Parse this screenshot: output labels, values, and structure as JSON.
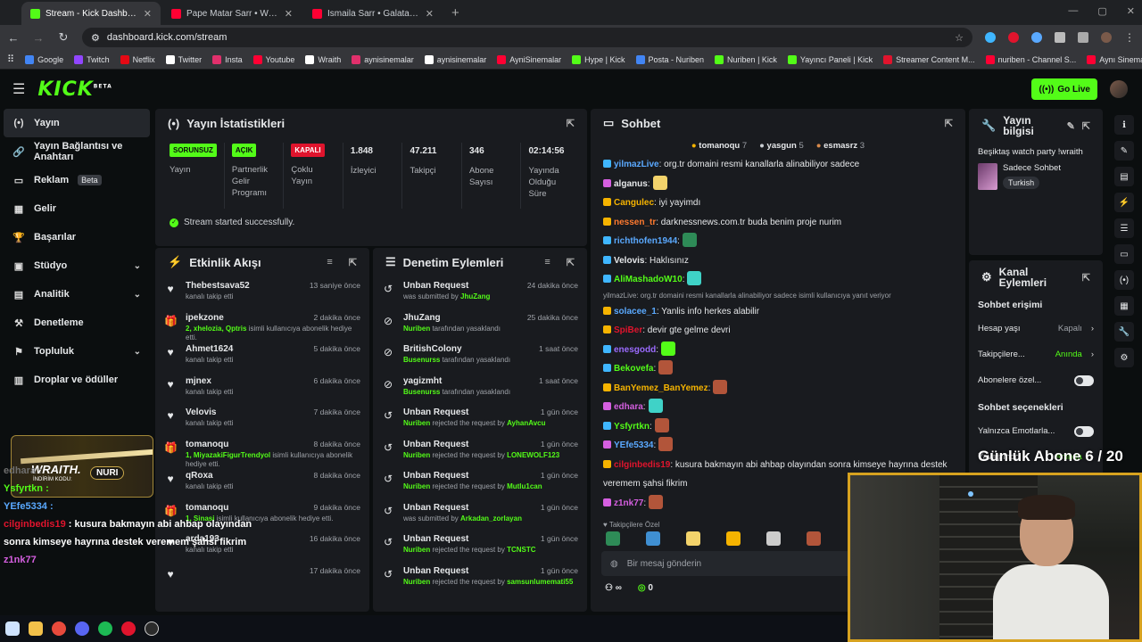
{
  "browser": {
    "tabs": [
      {
        "title": "Stream - Kick Dashboard",
        "color": "#53fc18"
      },
      {
        "title": "Pape Matar Sarr • Welcome to",
        "color": "#ff0033"
      },
      {
        "title": "Ismaila Sarr • Galatasaray Tran",
        "color": "#ff0033"
      }
    ],
    "url": "dashboard.kick.com/stream",
    "bookmarks": [
      {
        "label": "Google",
        "color": "#4285f4"
      },
      {
        "label": "Twitch",
        "color": "#9146ff"
      },
      {
        "label": "Netflix",
        "color": "#e50914"
      },
      {
        "label": "Twitter",
        "color": "#ffffff"
      },
      {
        "label": "Insta",
        "color": "#e1306c"
      },
      {
        "label": "Youtube",
        "color": "#ff0033"
      },
      {
        "label": "Wraith",
        "color": "#ffffff"
      },
      {
        "label": "aynisinemalar",
        "color": "#e1306c"
      },
      {
        "label": "aynisinemalar",
        "color": "#ffffff"
      },
      {
        "label": "AyniSinemalar",
        "color": "#ff0033"
      },
      {
        "label": "Hype | Kick",
        "color": "#53fc18"
      },
      {
        "label": "Posta - Nuriben",
        "color": "#4285f4"
      },
      {
        "label": "Nuriben | Kick",
        "color": "#53fc18"
      },
      {
        "label": "Yayıncı Paneli | Kick",
        "color": "#53fc18"
      },
      {
        "label": "Streamer Content M...",
        "color": "#e0142d"
      },
      {
        "label": "nuriben - Channel S...",
        "color": "#ff0033"
      },
      {
        "label": "Aynı Sinemalar - Ça...",
        "color": "#ff0033"
      }
    ]
  },
  "header": {
    "go_live": "Go Live"
  },
  "sidebar": {
    "items": [
      {
        "label": "Yayın",
        "icon": "(•)"
      },
      {
        "label": "Yayın Bağlantısı ve Anahtarı",
        "icon": "🔗"
      },
      {
        "label": "Reklam",
        "icon": "▭",
        "badge": "Beta"
      },
      {
        "label": "Gelir",
        "icon": "▦"
      },
      {
        "label": "Başarılar",
        "icon": "🏆"
      },
      {
        "label": "Stüdyo",
        "icon": "▣"
      },
      {
        "label": "Analitik",
        "icon": "▤"
      },
      {
        "label": "Denetleme",
        "icon": "⚒"
      },
      {
        "label": "Topluluk",
        "icon": "⚑"
      },
      {
        "label": "Droplar ve ödüller",
        "icon": "▥"
      }
    ],
    "promo": {
      "title": "WRAITH.",
      "code_label": "İNDİRİM KODU:",
      "code": "NURI"
    }
  },
  "stream_stats": {
    "title": "Yayın İstatistikleri",
    "stats": [
      {
        "badge": "SORUNSUZ",
        "label": "Yayın"
      },
      {
        "badge": "AÇIK",
        "label": "Partnerlik Gelir Programı"
      },
      {
        "badge": "KAPALI",
        "label": "Çoklu Yayın"
      },
      {
        "value": "1.848",
        "label": "İzleyici"
      },
      {
        "value": "47.211",
        "label": "Takipçi"
      },
      {
        "value": "346",
        "label": "Abone Sayısı"
      },
      {
        "value": "02:14:56",
        "label": "Yayında Olduğu Süre"
      }
    ],
    "status": "Stream started successfully."
  },
  "activity": {
    "title": "Etkinlik Akışı",
    "items": [
      {
        "icon": "♥",
        "name": "Thebestsava52",
        "time": "13 saniye önce",
        "sub": "kanalı takip etti"
      },
      {
        "icon": "🎁",
        "name": "ipekzone",
        "time": "2 dakika önce",
        "sub_highlight": "2, xhelozia, Qptris",
        "sub": " isimli kullanıcıya abonelik hediye etti."
      },
      {
        "icon": "♥",
        "name": "Ahmet1624",
        "time": "5 dakika önce",
        "sub": "kanalı takip etti"
      },
      {
        "icon": "♥",
        "name": "mjnex",
        "time": "6 dakika önce",
        "sub": "kanalı takip etti"
      },
      {
        "icon": "♥",
        "name": "Velovis",
        "time": "7 dakika önce",
        "sub": "kanalı takip etti"
      },
      {
        "icon": "🎁",
        "name": "tomanoqu",
        "time": "8 dakika önce",
        "sub_highlight": "1, MiyazakiFigurTrendyol",
        "sub": " isimli kullanıcıya abonelik hediye etti."
      },
      {
        "icon": "♥",
        "name": "qRoxa",
        "time": "8 dakika önce",
        "sub": "kanalı takip etti"
      },
      {
        "icon": "🎁",
        "name": "tomanoqu",
        "time": "9 dakika önce",
        "sub_highlight": "1, Sinasi",
        "sub": " isimli kullanıcıya abonelik hediye etti."
      },
      {
        "icon": "♥",
        "name": "arda193",
        "time": "16 dakika önce",
        "sub": "kanalı takip etti"
      },
      {
        "icon": "♥",
        "name": "",
        "time": "17 dakika önce",
        "sub": ""
      }
    ]
  },
  "moderation": {
    "title": "Denetim Eylemleri",
    "items": [
      {
        "icon": "↺",
        "name": "Unban Request",
        "time": "24 dakika önce",
        "pre": "was submitted by ",
        "hl": "JhuZang",
        "post": ""
      },
      {
        "icon": "⊘",
        "name": "JhuZang",
        "time": "25 dakika önce",
        "pre": "",
        "hl": "Nuriben",
        "post": " tarafından yasaklandı"
      },
      {
        "icon": "⊘",
        "name": "BritishColony",
        "time": "1 saat önce",
        "pre": "",
        "hl": "Busenurss",
        "post": " tarafından yasaklandı"
      },
      {
        "icon": "⊘",
        "name": "yagizmht",
        "time": "1 saat önce",
        "pre": "",
        "hl": "Busenurss",
        "post": " tarafından yasaklandı"
      },
      {
        "icon": "↺",
        "name": "Unban Request",
        "time": "1 gün önce",
        "pre": "",
        "hl": "Nuriben",
        "post": " rejected the request by ",
        "hl2": "AyhanAvcu"
      },
      {
        "icon": "↺",
        "name": "Unban Request",
        "time": "1 gün önce",
        "pre": "",
        "hl": "Nuriben",
        "post": " rejected the request by ",
        "hl2": "LONEWOLF123"
      },
      {
        "icon": "↺",
        "name": "Unban Request",
        "time": "1 gün önce",
        "pre": "",
        "hl": "Nuriben",
        "post": " rejected the request by ",
        "hl2": "Mutlu1can"
      },
      {
        "icon": "↺",
        "name": "Unban Request",
        "time": "1 gün önce",
        "pre": "was submitted by ",
        "hl": "Arkadan_zorlayan",
        "post": ""
      },
      {
        "icon": "↺",
        "name": "Unban Request",
        "time": "1 gün önce",
        "pre": "",
        "hl": "Nuriben",
        "post": " rejected the request by ",
        "hl2": "TCNSTC"
      },
      {
        "icon": "↺",
        "name": "Unban Request",
        "time": "1 gün önce",
        "pre": "",
        "hl": "Nuriben",
        "post": " rejected the request by ",
        "hl2": "samsunlumemati55"
      }
    ]
  },
  "chat": {
    "title": "Sohbet",
    "leaders": [
      {
        "name": "tomanoqu",
        "count": "7",
        "color": "#f5b300"
      },
      {
        "name": "yasgun",
        "count": "5",
        "color": "#c9cdd2"
      },
      {
        "name": "esmasrz",
        "count": "3",
        "color": "#d88a4a"
      }
    ],
    "messages": [
      {
        "user": "yilmazLive",
        "color": "#5aa9ff",
        "badge": "#3fb6ff",
        "text": ": org.tr domaini resmi kanallarla alinabiliyor sadece",
        "emote": ""
      },
      {
        "user": "alganus",
        "color": "#e6e8ea",
        "badge": "#d55fe0",
        "text": ":",
        "emote": "#f3d36b"
      },
      {
        "user": "Cangulec",
        "color": "#f5b300",
        "badge": "#f5b300",
        "text": ": iyi yayimdı",
        "emote": ""
      },
      {
        "user": "nessen_tr",
        "color": "#ff7a2f",
        "badge": "#f5b300",
        "text": ": darknessnews.com.tr buda benim proje nurim",
        "emote": ""
      },
      {
        "user": "richthofen1944",
        "color": "#5aa9ff",
        "badge": "#3fb6ff",
        "text": ":",
        "emote": "#2e8b57"
      },
      {
        "user": "Velovis",
        "color": "#e6e8ea",
        "badge": "#3fb6ff",
        "text": ": Haklısınız",
        "emote": ""
      },
      {
        "user": "AliMashadoW10",
        "color": "#53fc18",
        "badge": "#3fb6ff",
        "text": ":",
        "emote": "#3fd2c7"
      },
      {
        "reply": "yilmazLive: org.tr domaini resmi kanallarla alinabiliyor sadece isimli kullanıcıya yanıt veriyor"
      },
      {
        "user": "solacee_1",
        "color": "#5aa9ff",
        "badge": "#f5b300",
        "text": ": Yanlis info herkes alabilir",
        "emote": ""
      },
      {
        "user": "SpiBer",
        "color": "#e0142d",
        "badge": "#f5b300",
        "text": ": devir gte gelme devri",
        "emote": ""
      },
      {
        "user": "enesgodd",
        "color": "#9b6bff",
        "badge": "#3fb6ff",
        "text": ":",
        "emote": "#53fc18"
      },
      {
        "user": "Bekovefa",
        "color": "#53fc18",
        "badge": "#3fb6ff",
        "text": ":",
        "emote": "#b2553a"
      },
      {
        "user": "BanYemez_BanYemez",
        "color": "#f5b300",
        "badge": "#f5b300",
        "text": ":",
        "emote": "#b2553a"
      },
      {
        "user": "edhara",
        "color": "#d55fe0",
        "badge": "#d55fe0",
        "text": ":",
        "emote": "#3fd2c7"
      },
      {
        "user": "Ysfyrtkn",
        "color": "#53fc18",
        "badge": "#3fb6ff",
        "text": ":",
        "emote": "#b2553a"
      },
      {
        "user": "YEfe5334",
        "color": "#5aa9ff",
        "badge": "#d55fe0",
        "text": ":",
        "emote": "#b2553a"
      },
      {
        "user": "cilginbedis19",
        "color": "#e0142d",
        "badge": "#f5b300",
        "text": ": kusura bakmayın abi ahbap olayından sonra kimseye hayrına destek",
        "emote": ""
      },
      {
        "cont": "veremem şahsi fikrim"
      },
      {
        "user": "z1nk77",
        "color": "#d55fe0",
        "badge": "#d55fe0",
        "text": ":",
        "emote": "#b2553a"
      }
    ],
    "followers_only": "Takipçilere Özel",
    "input_placeholder": "Bir mesaj gönderin",
    "footer_count": "0"
  },
  "stream_info": {
    "title": "Yayın bilgisi",
    "stream_title": "Beşiktaş watch party !wraith",
    "category": "Sadece Sohbet",
    "tag": "Turkish"
  },
  "channel_actions": {
    "title": "Kanal Eylemleri",
    "chat_access": "Sohbet erişimi",
    "rows": [
      {
        "label": "Hesap yaşı",
        "value": "Kapalı",
        "kind": "grey"
      },
      {
        "label": "Takipçilere...",
        "value": "Anında",
        "kind": "green"
      },
      {
        "label": "Abonelere özel...",
        "value": "",
        "kind": "toggle"
      }
    ],
    "chat_options": "Sohbet seçenekleri",
    "rows2": [
      {
        "label": "Yalnızca Emotlarla...",
        "value": "",
        "kind": "toggle"
      },
      {
        "label": "Yavaş mod",
        "value": "Anında",
        "kind": "green"
      }
    ]
  },
  "overlay": {
    "abone": "Günlük Abone 6 / 20",
    "side_chat": [
      {
        "user": "edhara :",
        "color": "#6f6f6f",
        "text": ""
      },
      {
        "user": "Ysfyrtkn :",
        "color": "#53fc18",
        "text": ""
      },
      {
        "user": "YEfe5334 :",
        "color": "#5aa9ff",
        "text": ""
      },
      {
        "user": "cilginbedis19",
        "color": "#e0142d",
        "text": " : kusura bakmayın abi ahbap olayından"
      },
      {
        "user": "",
        "color": "#ffffff",
        "text": "sonra kimseye hayrına destek veremem şahsi fikrim"
      },
      {
        "user": "z1nk77",
        "color": "#d55fe0",
        "text": ""
      }
    ]
  }
}
